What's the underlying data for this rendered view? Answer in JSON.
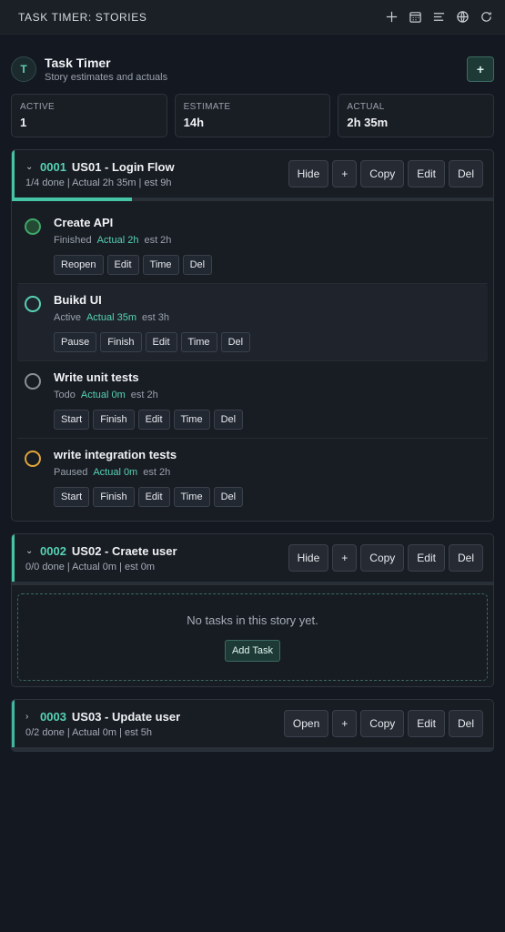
{
  "window": {
    "title": "TASK TIMER: STORIES",
    "icons": [
      "plus-icon",
      "calendar-icon",
      "list-icon",
      "globe-icon",
      "refresh-icon"
    ]
  },
  "header": {
    "avatar_letter": "T",
    "app_name": "Task Timer",
    "subtitle": "Story estimates and actuals",
    "add_label": "+"
  },
  "stats": [
    {
      "label": "ACTIVE",
      "value": "1"
    },
    {
      "label": "ESTIMATE",
      "value": "14h"
    },
    {
      "label": "ACTUAL",
      "value": "2h 35m"
    }
  ],
  "stories": [
    {
      "id": "0001",
      "name": "US01 - Login Flow",
      "meta": "1/4 done | Actual 2h 35m | est 9h",
      "expanded": true,
      "progress": 0.25,
      "buttons": [
        "Hide",
        "+",
        "Copy",
        "Edit",
        "Del"
      ],
      "tasks": [
        {
          "name": "Create API",
          "status": "Finished",
          "actual": "Actual 2h",
          "est": "est 2h",
          "dot_color": "#3ea86a",
          "dot_fill": "#244a33",
          "buttons": [
            "Reopen",
            "Edit",
            "Time",
            "Del"
          ],
          "active": false
        },
        {
          "name": "Buikd UI",
          "status": "Active",
          "actual": "Actual 35m",
          "est": "est 3h",
          "dot_color": "#56d2b4",
          "dot_fill": "transparent",
          "buttons": [
            "Pause",
            "Finish",
            "Edit",
            "Time",
            "Del"
          ],
          "active": true
        },
        {
          "name": "Write unit tests",
          "status": "Todo",
          "actual": "Actual 0m",
          "est": "est 2h",
          "dot_color": "#8a8f97",
          "dot_fill": "transparent",
          "buttons": [
            "Start",
            "Finish",
            "Edit",
            "Time",
            "Del"
          ],
          "active": false
        },
        {
          "name": "write integration tests",
          "status": "Paused",
          "actual": "Actual 0m",
          "est": "est 2h",
          "dot_color": "#e0a53a",
          "dot_fill": "transparent",
          "buttons": [
            "Start",
            "Finish",
            "Edit",
            "Time",
            "Del"
          ],
          "active": false
        }
      ]
    },
    {
      "id": "0002",
      "name": "US02 - Craete user",
      "meta": "0/0 done | Actual 0m | est 0m",
      "expanded": true,
      "progress": 0,
      "buttons": [
        "Hide",
        "+",
        "Copy",
        "Edit",
        "Del"
      ],
      "tasks": [],
      "empty_message": "No tasks in this story yet.",
      "add_task_label": "Add Task"
    },
    {
      "id": "0003",
      "name": "US03 - Update user",
      "meta": "0/2 done | Actual 0m | est 5h",
      "expanded": false,
      "progress": 0,
      "buttons": [
        "Open",
        "+",
        "Copy",
        "Edit",
        "Del"
      ],
      "tasks": []
    }
  ],
  "colors": {
    "accent": "#45c4a6",
    "background": "#141820",
    "card": "#181c23"
  }
}
